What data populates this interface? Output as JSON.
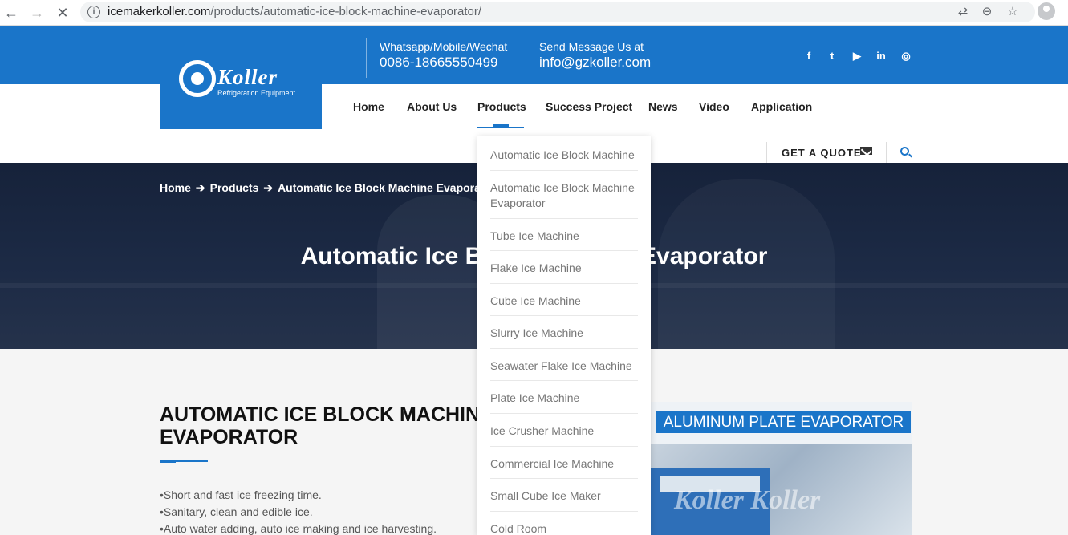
{
  "browser": {
    "url_domain": "icemakerkoller.com",
    "url_path": "/products/automatic-ice-block-machine-evaporator/",
    "back_icon": "back-arrow-icon",
    "forward_icon": "forward-arrow-icon",
    "stop_icon": "close-icon"
  },
  "topbar": {
    "phone_label": "Whatsapp/Mobile/Wechat",
    "phone_value": "0086-18665550499",
    "email_label": "Send Message Us at",
    "email_value": "info@gzkoller.com",
    "social": [
      "f",
      "t",
      "▶",
      "in",
      "◎"
    ]
  },
  "logo": {
    "name": "Koller",
    "subtitle": "Refrigeration Equipment"
  },
  "menu": {
    "items": [
      "Home",
      "About Us",
      "Products",
      "Success Project",
      "News",
      "Video",
      "Application"
    ],
    "active": "Products",
    "quote_label": "GET A QUOTE"
  },
  "hero": {
    "breadcrumb": [
      "Home",
      "Products",
      "Automatic Ice Block Machine Evaporator"
    ],
    "title": "Automatic Ice Block Machine Evaporator"
  },
  "content": {
    "title": "AUTOMATIC ICE BLOCK MACHINE EVAPORATOR",
    "bullets": [
      "•Short and fast ice freezing time.",
      "•Sanitary, clean and edible ice.",
      "•Auto water adding, auto ice making and ice harvesting."
    ],
    "image_banner": "ALUMINUM PLATE EVAPORATOR",
    "image_watermark": "Koller   Koller"
  },
  "dropdown": {
    "items": [
      "Automatic Ice Block Machine",
      "Automatic Ice Block Machine Evaporator",
      "Tube Ice Machine",
      "Flake Ice Machine",
      "Cube Ice Machine",
      "Slurry Ice Machine",
      "Seawater Flake Ice Machine",
      "Plate Ice Machine",
      "Ice Crusher Machine",
      "Commercial Ice Machine",
      "Small Cube Ice Maker",
      "Cold Room"
    ]
  },
  "colors": {
    "brand_blue": "#1a75c9",
    "hero_dark": "#1c2a45"
  }
}
